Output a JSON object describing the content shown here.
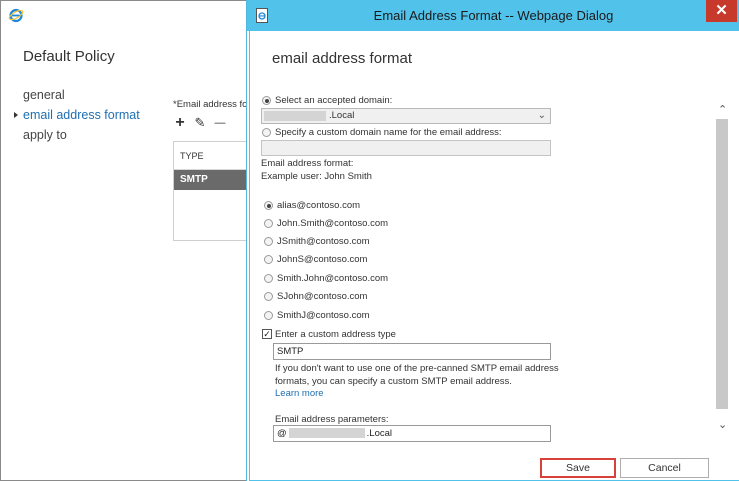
{
  "background": {
    "policy_title": "Default Policy",
    "nav": [
      "general",
      "email address format",
      "apply to"
    ],
    "field_label": "*Email address fo",
    "toolbar": {
      "add": "+",
      "edit": "✎",
      "remove": "—"
    },
    "table": {
      "header": "TYPE",
      "row": "SMTP"
    }
  },
  "dialog": {
    "title": "Email Address Format -- Webpage Dialog",
    "close": "✕",
    "heading": "email address format",
    "accepted_domain_label": "Select an accepted domain:",
    "accepted_domain_value": ".Local",
    "custom_domain_label": "Specify a custom domain name for the email address:",
    "format_label": "Email address format:",
    "example_user": "Example user: John Smith",
    "formats": [
      {
        "label": "alias@contoso.com",
        "checked": true
      },
      {
        "label": "John.Smith@contoso.com",
        "checked": false
      },
      {
        "label": "JSmith@contoso.com",
        "checked": false
      },
      {
        "label": "JohnS@contoso.com",
        "checked": false
      },
      {
        "label": "Smith.John@contoso.com",
        "checked": false
      },
      {
        "label": "SJohn@contoso.com",
        "checked": false
      },
      {
        "label": "SmithJ@contoso.com",
        "checked": false
      }
    ],
    "custom_type_label": "Enter a custom address type",
    "custom_type_checked": true,
    "custom_type_value": "SMTP",
    "info_text": "If you don't want to use one of the pre-canned SMTP email address formats, you can specify a custom SMTP email address.",
    "learn_more": "Learn more",
    "params_label": "Email address parameters:",
    "params_prefix": "@",
    "params_suffix": ".Local",
    "save_label": "Save",
    "cancel_label": "Cancel",
    "colors": {
      "titlebar": "#51c3ea",
      "close": "#c7392b",
      "save_highlight": "#d8413a",
      "link": "#1f6fb2"
    }
  }
}
